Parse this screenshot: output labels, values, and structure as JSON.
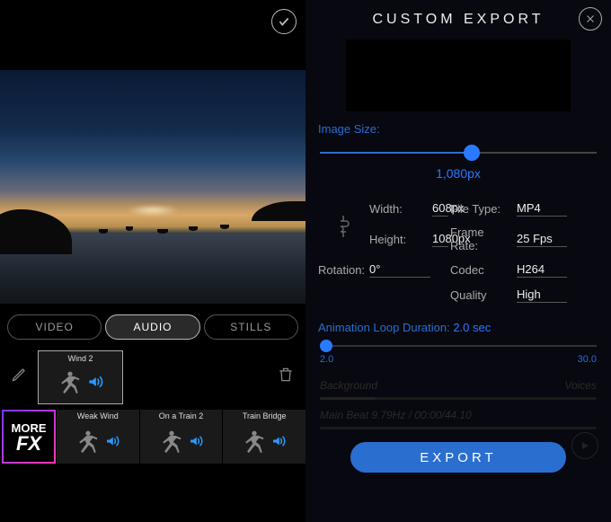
{
  "left": {
    "modes": {
      "video": "VIDEO",
      "audio": "AUDIO",
      "stills": "STILLS",
      "selected": "audio"
    },
    "selected_card": {
      "label": "Wind 2"
    },
    "fx": {
      "more_top": "MORE",
      "more_bottom": "FX",
      "cards": [
        {
          "label": "Weak Wind"
        },
        {
          "label": "On a Train 2"
        },
        {
          "label": "Train Bridge"
        }
      ]
    }
  },
  "export": {
    "title": "CUSTOM  EXPORT",
    "image_size_label": "Image Size:",
    "image_size_value": "1,080px",
    "slider_pct": 55,
    "width_label": "Width:",
    "width_value": "608px",
    "height_label": "Height:",
    "height_value": "1080px",
    "rotation_label": "Rotation:",
    "rotation_value": "0°",
    "filetype_label": "File Type:",
    "filetype_value": "MP4",
    "framerate_label": "Frame Rate:",
    "framerate_value": "25 Fps",
    "codec_label": "Codec",
    "codec_value": "H264",
    "quality_label": "Quality",
    "quality_value": "High",
    "loop_label": "Animation Loop Duration:",
    "loop_value": "2.0 sec",
    "loop_min": "2.0",
    "loop_max": "30.0",
    "faded": {
      "bg": "Background",
      "voices": "Voices",
      "beat": "Main Beat 9.79Hz / 00:00/44.10"
    },
    "export_button": "EXPORT"
  }
}
